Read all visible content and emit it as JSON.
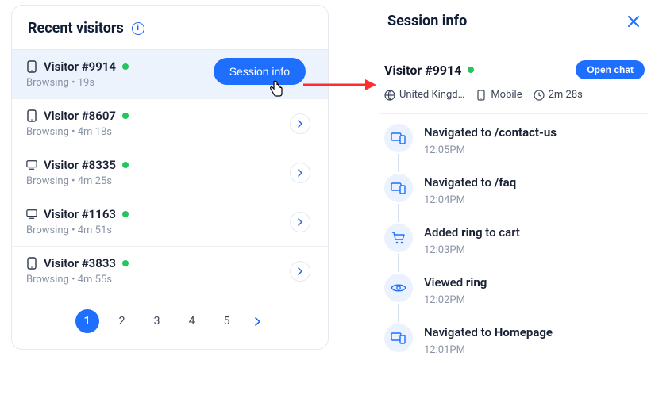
{
  "left": {
    "title": "Recent visitors",
    "visitors": [
      {
        "name": "Visitor #9914",
        "status": "Browsing • 19s",
        "device": "mobile",
        "highlighted": true
      },
      {
        "name": "Visitor #8607",
        "status": "Browsing • 4m 18s",
        "device": "mobile"
      },
      {
        "name": "Visitor #8335",
        "status": "Browsing • 4m 25s",
        "device": "desktop"
      },
      {
        "name": "Visitor #1163",
        "status": "Browsing • 4m 51s",
        "device": "desktop"
      },
      {
        "name": "Visitor #3833",
        "status": "Browsing • 4m 55s",
        "device": "mobile"
      }
    ],
    "session_info_btn": "Session info",
    "pages": [
      "1",
      "2",
      "3",
      "4",
      "5"
    ]
  },
  "right": {
    "title": "Session info",
    "visitor": "Visitor #9914",
    "open_chat": "Open chat",
    "meta": {
      "country": "United Kingd…",
      "device": "Mobile",
      "duration": "2m 28s"
    },
    "timeline": [
      {
        "icon": "device",
        "prefix": "Navigated to ",
        "bold": "/contact-us",
        "suffix": "",
        "time": "12:05PM"
      },
      {
        "icon": "device",
        "prefix": "Navigated to ",
        "bold": "/faq",
        "suffix": "",
        "time": "12:04PM"
      },
      {
        "icon": "cart",
        "prefix": "Added ",
        "bold": "ring",
        "suffix": " to cart",
        "time": "12:03PM"
      },
      {
        "icon": "eye",
        "prefix": "Viewed ",
        "bold": "ring",
        "suffix": "",
        "time": "12:02PM"
      },
      {
        "icon": "device",
        "prefix": "Navigated to ",
        "bold": "Homepage",
        "suffix": "",
        "time": "12:01PM"
      }
    ]
  }
}
